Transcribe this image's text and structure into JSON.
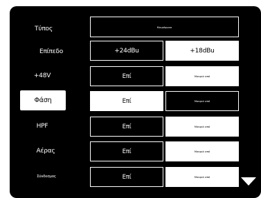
{
  "labels": {
    "type": "Τύπος",
    "level": "Επίπεδο",
    "phantom": "+48V",
    "phase": "Φάση",
    "hpf": "HPF",
    "air": "Αέρας",
    "link": "Σύνδεσμος"
  },
  "values": {
    "type": "Μικρόφωνο",
    "level_high": "+24dBu",
    "level_low": "+18dBu",
    "on": "Επί",
    "off": "Μακριά από"
  },
  "selected_row": "phase",
  "icons": {
    "scroll_down": "down-triangle-icon"
  }
}
